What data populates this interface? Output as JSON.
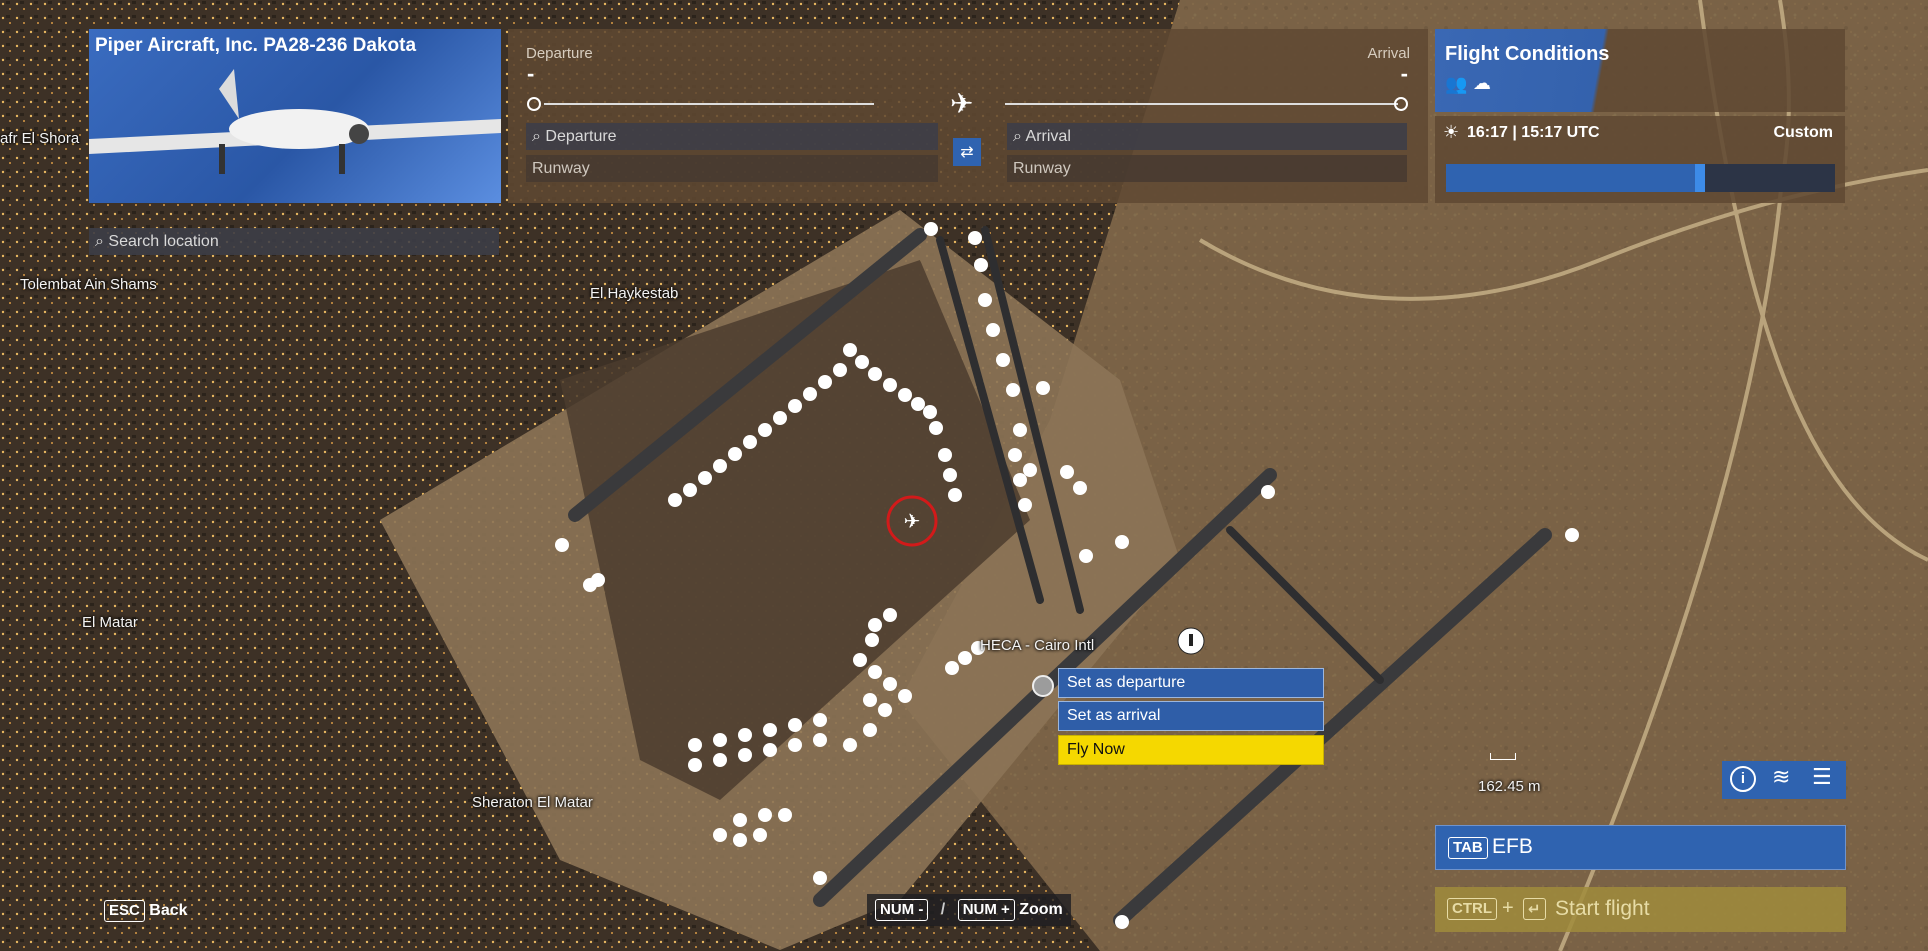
{
  "aircraft": {
    "name": "Piper Aircraft, Inc. PA28-236 Dakota"
  },
  "search": {
    "placeholder": "Search location"
  },
  "route": {
    "departure_label": "Departure",
    "departure_value": "-",
    "arrival_label": "Arrival",
    "arrival_value": "-",
    "departure_field_placeholder": "Departure",
    "arrival_field_placeholder": "Arrival",
    "departure_runway": "Runway",
    "arrival_runway": "Runway"
  },
  "conditions": {
    "title": "Flight Conditions",
    "time": "16:17 | 15:17 UTC",
    "mode": "Custom",
    "time_slider_fraction": 0.64
  },
  "map_labels": {
    "l1": "afr El Shora",
    "l2": "Tolembat Ain Shams",
    "l3": "El Haykestab",
    "l4": "El Matar",
    "l5": "Sheraton El Matar",
    "airport": "HECA - Cairo Intl"
  },
  "context_menu": {
    "set_departure": "Set as departure",
    "set_arrival": "Set as arrival",
    "fly_now": "Fly Now"
  },
  "scale": {
    "text": "162.45 m"
  },
  "efb": {
    "key": "TAB",
    "label": "EFB"
  },
  "start_flight": {
    "key": "CTRL",
    "plus": "+",
    "enter": "↵",
    "label": "Start flight"
  },
  "back": {
    "key": "ESC",
    "label": "Back"
  },
  "zoom": {
    "key_minus": "NUM -",
    "sep": "/",
    "key_plus": "NUM +",
    "label": "Zoom"
  },
  "colors": {
    "accent": "#2f63b0",
    "fly_now": "#f5d800",
    "panel": "#5f4832"
  }
}
